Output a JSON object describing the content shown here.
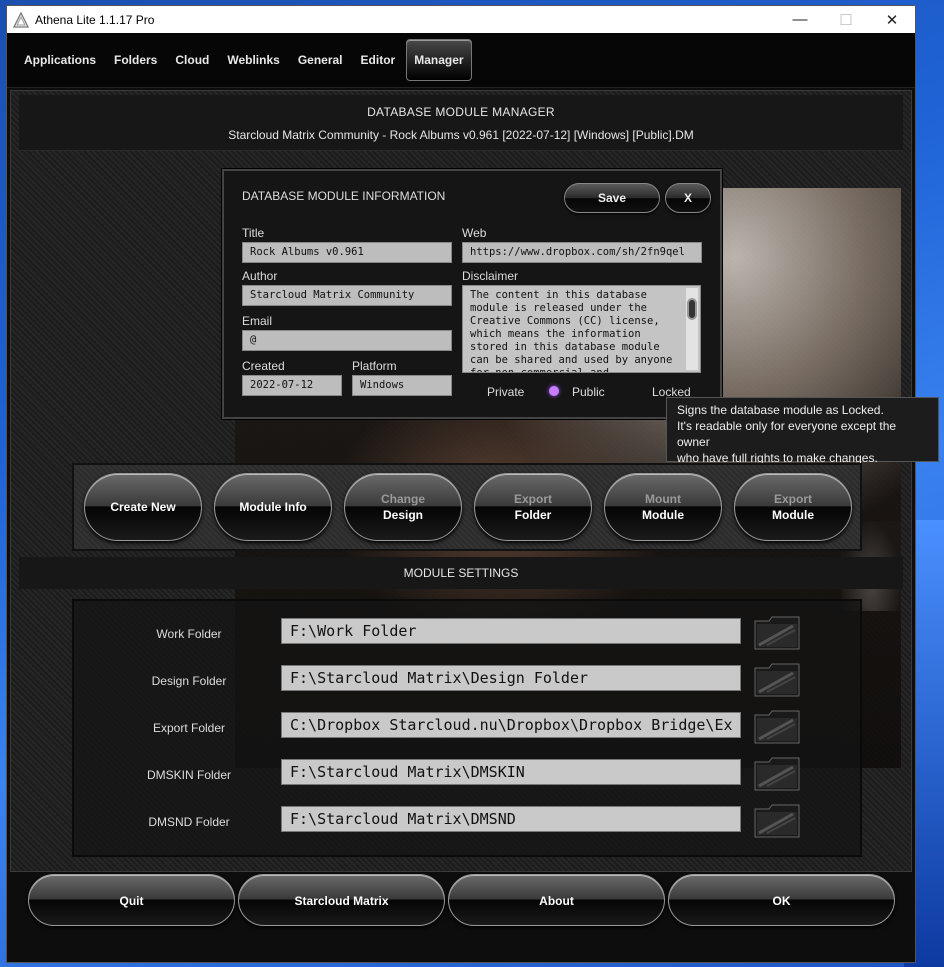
{
  "window": {
    "title": "Athena Lite 1.1.17 Pro",
    "minimize": "—",
    "maximize": "☐",
    "close": "✕"
  },
  "menu": {
    "items": [
      "Applications",
      "Folders",
      "Cloud",
      "Weblinks",
      "General",
      "Editor",
      "Manager"
    ],
    "active": "Manager"
  },
  "header": {
    "title": "DATABASE MODULE MANAGER",
    "subtitle": "Starcloud Matrix Community - Rock Albums v0.961 [2022-07-12] [Windows] [Public].DM"
  },
  "info_dialog": {
    "title": "DATABASE MODULE INFORMATION",
    "save_label": "Save",
    "close_label": "X",
    "title_label": "Title",
    "title_value": "Rock Albums v0.961",
    "author_label": "Author",
    "author_value": "Starcloud Matrix Community",
    "email_label": "Email",
    "email_value": "@",
    "created_label": "Created",
    "created_value": "2022-07-12",
    "platform_label": "Platform",
    "platform_value": "Windows",
    "web_label": "Web",
    "web_value": "https://www.dropbox.com/sh/2fn9qel",
    "disclaimer_label": "Disclaimer",
    "disclaimer_value": "The content in this database module is released under the Creative Commons (CC) license, which means the information stored in this database module can be shared and used by anyone for non-commercial and",
    "private_label": "Private",
    "public_label": "Public",
    "locked_label": "Locked",
    "selected_visibility": "Public"
  },
  "tooltip": {
    "line1": "Signs the database module as Locked.",
    "line2": "It's readable only for everyone except the owner",
    "line3": "who have full rights to make changes."
  },
  "actions": [
    {
      "top": "",
      "bottom": "Create New"
    },
    {
      "top": "",
      "bottom": "Module Info"
    },
    {
      "top": "Change",
      "bottom": "Design"
    },
    {
      "top": "Export",
      "bottom": "Folder"
    },
    {
      "top": "Mount",
      "bottom": "Module"
    },
    {
      "top": "Export",
      "bottom": "Module"
    }
  ],
  "settings": {
    "title": "MODULE SETTINGS",
    "rows": [
      {
        "label": "Work Folder",
        "value": "F:\\Work Folder"
      },
      {
        "label": "Design Folder",
        "value": "F:\\Starcloud Matrix\\Design Folder"
      },
      {
        "label": "Export Folder",
        "value": "C:\\Dropbox Starcloud.nu\\Dropbox\\Dropbox Bridge\\Ex"
      },
      {
        "label": "DMSKIN Folder",
        "value": "F:\\Starcloud Matrix\\DMSKIN"
      },
      {
        "label": "DMSND Folder",
        "value": "F:\\Starcloud Matrix\\DMSND"
      }
    ]
  },
  "footer": {
    "quit": "Quit",
    "starcloud": "Starcloud Matrix",
    "about": "About",
    "ok": "OK"
  },
  "colors": {
    "accent_radio": "#c77dff",
    "desktop_blue": "#1f63d6"
  }
}
